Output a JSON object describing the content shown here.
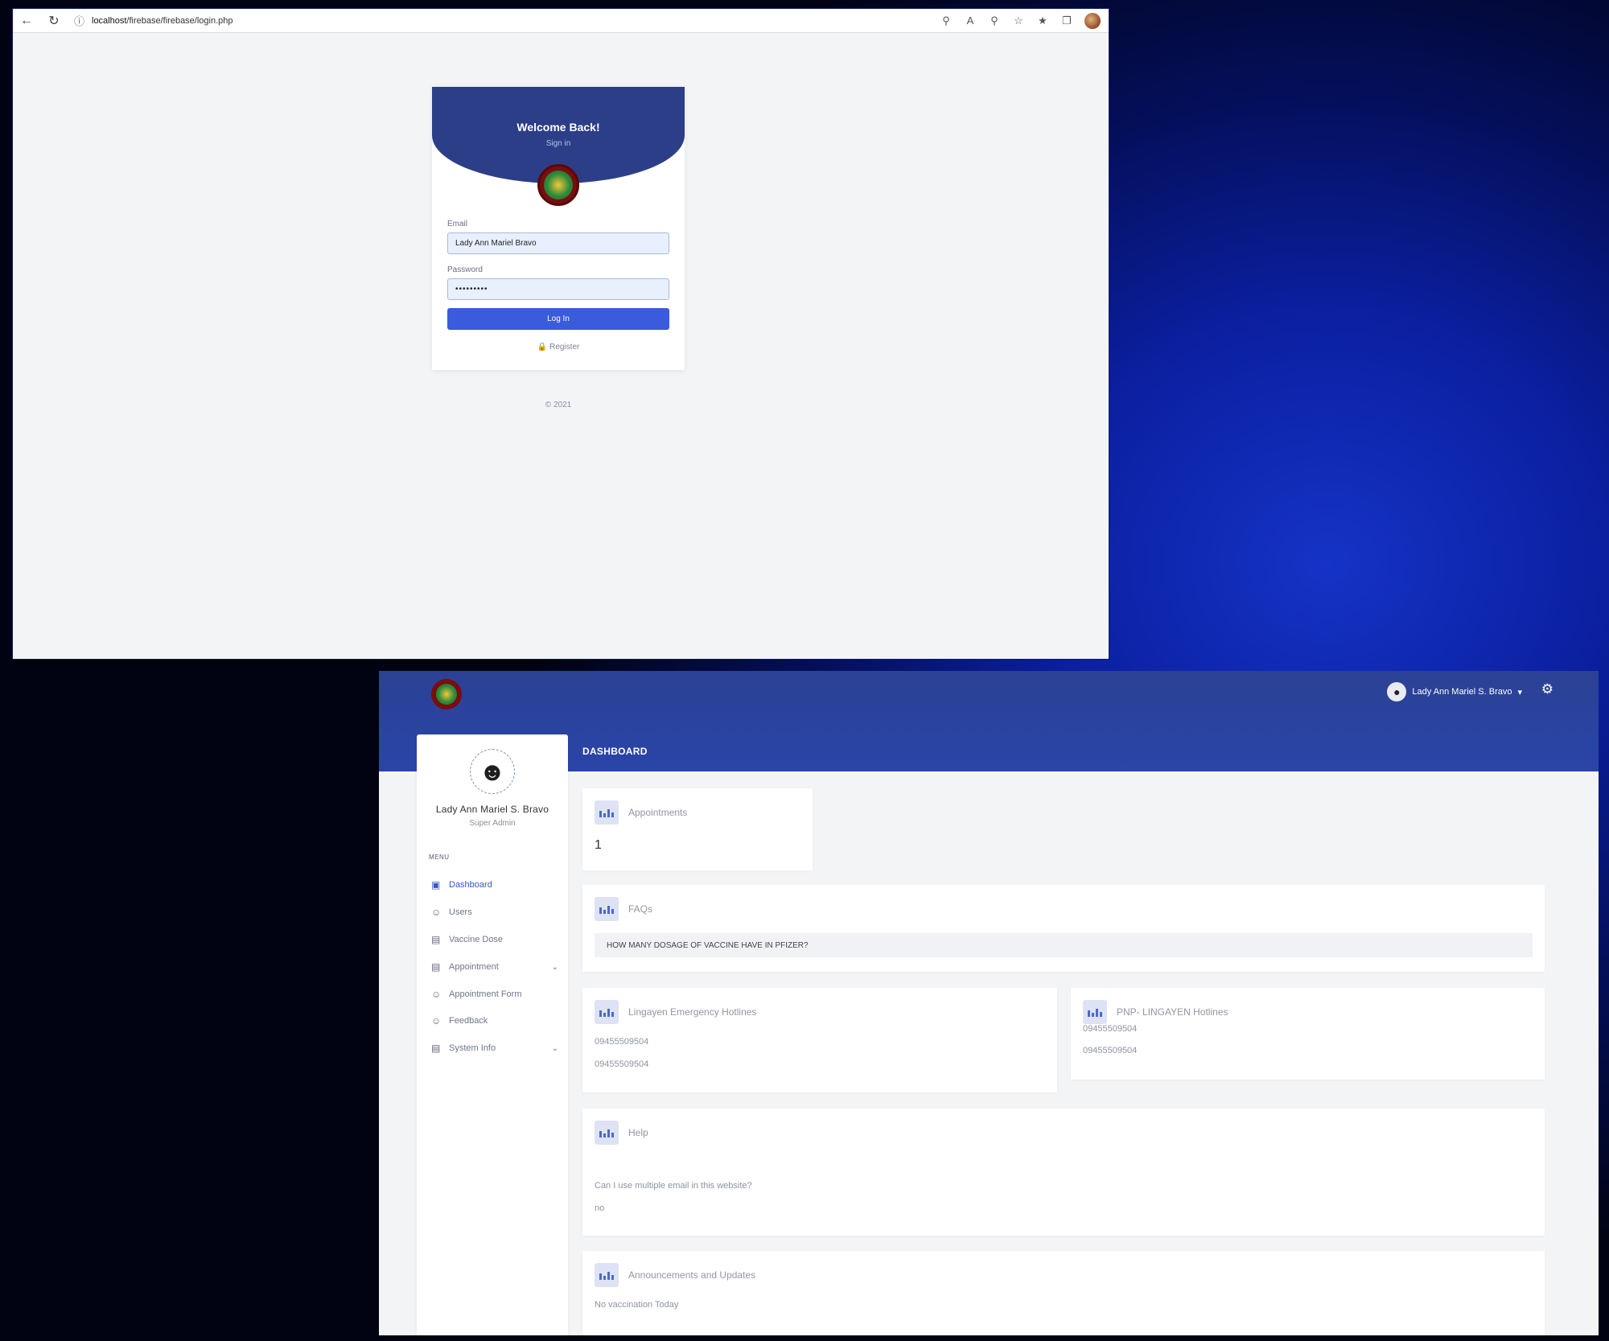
{
  "login": {
    "url_host": "localhost",
    "url_path": "/firebase/firebase/login.php",
    "welcome": "Welcome Back!",
    "subtitle": "Sign in",
    "email_label": "Email",
    "email_value": "Lady Ann Mariel Bravo",
    "password_label": "Password",
    "password_value": "•••••••••",
    "login_button": "Log In",
    "register_link": "Register",
    "copyright": "© 2021"
  },
  "dashboard": {
    "user_name": "Lady Ann Mariel S. Bravo",
    "page_title": "DASHBOARD",
    "profile": {
      "name": "Lady Ann Mariel S. Bravo",
      "role": "Super Admin"
    },
    "menu_heading": "MENU",
    "menu": [
      {
        "label": "Dashboard"
      },
      {
        "label": "Users"
      },
      {
        "label": "Vaccine Dose"
      },
      {
        "label": "Appointment"
      },
      {
        "label": "Appointment Form"
      },
      {
        "label": "Feedback"
      },
      {
        "label": "System Info"
      }
    ],
    "appointments": {
      "title": "Appointments",
      "count": "1"
    },
    "faqs": {
      "title": "FAQs",
      "question": "HOW MANY DOSAGE OF VACCINE HAVE IN PFIZER?"
    },
    "emergency": {
      "title": "Lingayen Emergency Hotlines",
      "numbers": [
        "09455509504",
        "09455509504"
      ]
    },
    "pnp": {
      "title": "PNP- LINGAYEN Hotlines",
      "numbers": [
        "09455509504",
        "09455509504"
      ]
    },
    "help": {
      "title": "Help",
      "question": "Can I use multiple email in this website?",
      "answer": "no"
    },
    "announcements": {
      "title": "Announcements and Updates",
      "text": "No vaccination Today"
    }
  },
  "colors": {
    "header": "#2c3e88",
    "accent": "#3a5bdc",
    "menu_active": "#3654c9"
  }
}
